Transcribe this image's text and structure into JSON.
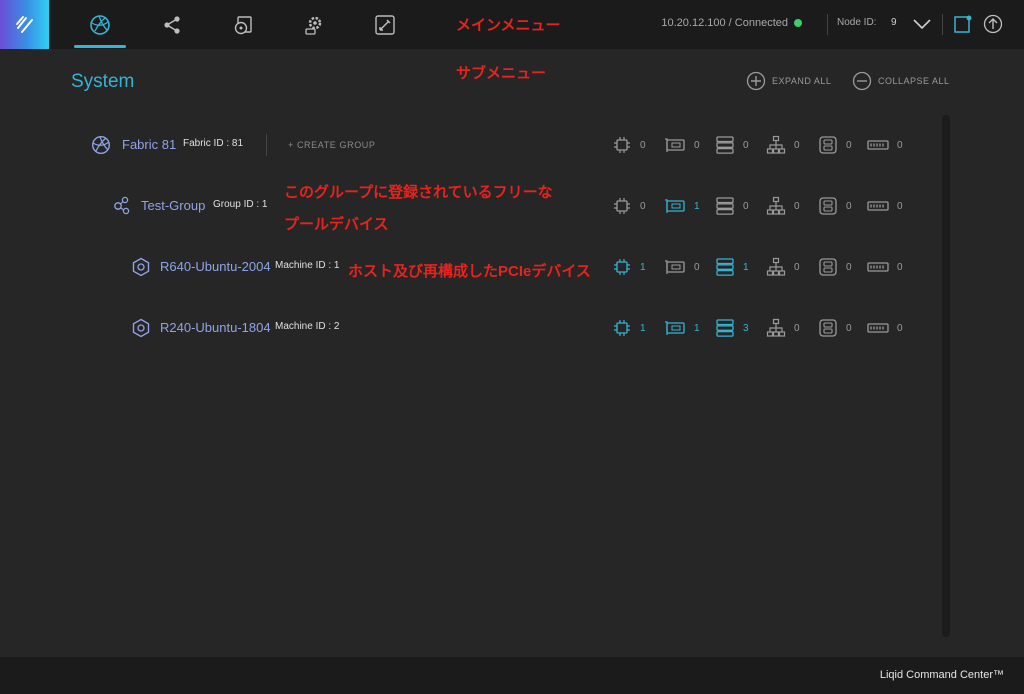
{
  "header": {
    "connection": "10.20.12.100 / Connected",
    "node_label": "Node ID:",
    "node_value": "9",
    "nav": [
      "fabric-icon",
      "share-icon",
      "storage-icon",
      "settings-gear-icon",
      "edit-icon"
    ]
  },
  "annotations": {
    "main_menu": "メインメニュー",
    "sub_menu": "サブメニュー",
    "free_pool_line1": "このグループに登録されているフリーな",
    "free_pool_line2": "プールデバイス",
    "host_devices": "ホスト及び再構成したPCIeデバイス"
  },
  "system": {
    "title": "System",
    "expand_all": "EXPAND ALL",
    "collapse_all": "COLLAPSE ALL"
  },
  "rows": [
    {
      "name": "Fabric 81",
      "id_text": "Fabric ID : 81",
      "create_group": "+ CREATE GROUP",
      "counts": [
        "0",
        "0",
        "0",
        "0",
        "0",
        "0"
      ]
    },
    {
      "name": "Test-Group",
      "id_text": "Group ID : 1",
      "counts": [
        "0",
        "1",
        "0",
        "0",
        "0",
        "0"
      ]
    },
    {
      "name": "R640-Ubuntu-2004",
      "id_text": "Machine ID : 1",
      "counts": [
        "1",
        "0",
        "1",
        "0",
        "0",
        "0"
      ]
    },
    {
      "name": "R240-Ubuntu-1804",
      "id_text": "Machine ID : 2",
      "counts": [
        "1",
        "1",
        "3",
        "0",
        "0",
        "0"
      ]
    }
  ],
  "device_types": [
    "cpu-chip-icon",
    "gpu-card-icon",
    "storage-drive-icon",
    "network-icon",
    "fpga-icon",
    "memory-icon"
  ],
  "colors": {
    "accent": "#36b3d3",
    "name": "#8fa4e6",
    "annotation": "#e8231e",
    "connected": "#3fcf6a"
  },
  "footer": {
    "brand": "Liqid Command Center™"
  }
}
